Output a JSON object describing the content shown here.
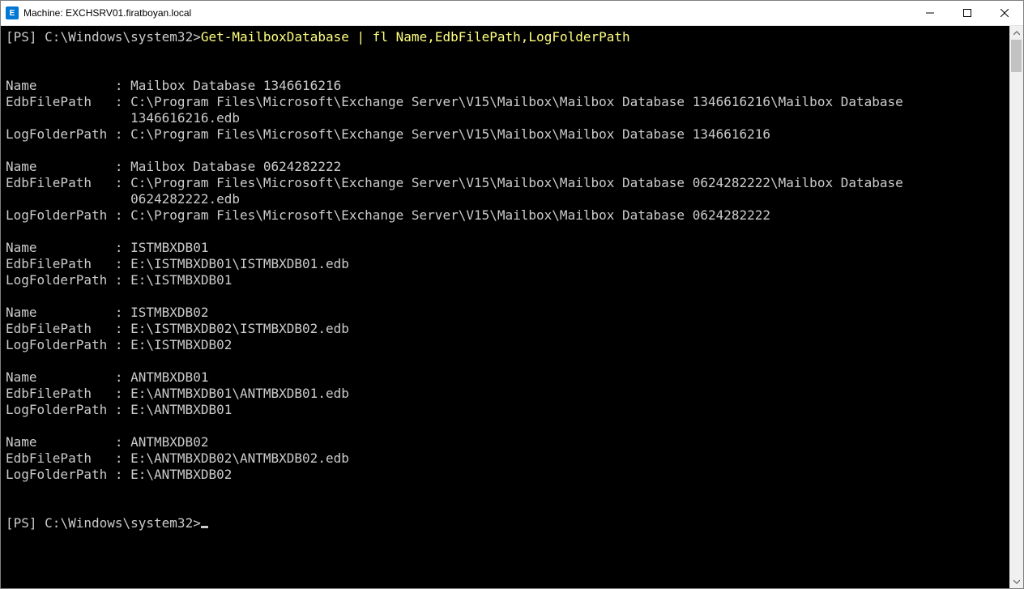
{
  "window": {
    "title": "Machine: EXCHSRV01.firatboyan.local",
    "app_icon_letter": "E"
  },
  "colors": {
    "prompt_fg": "#cccccc",
    "command_fg": "#ffff80",
    "output_fg": "#cccccc",
    "console_bg": "#000000",
    "titlebar_bg": "#ffffff",
    "accent": "#0078d4"
  },
  "prompt": {
    "label": "[PS]",
    "path": "C:\\Windows\\system32",
    "sep": ">"
  },
  "command": "Get-MailboxDatabase | fl Name,EdbFilePath,LogFolderPath",
  "blank": "",
  "output": {
    "r0": {
      "l0": "Name          : Mailbox Database 1346616216",
      "l1": "EdbFilePath   : C:\\Program Files\\Microsoft\\Exchange Server\\V15\\Mailbox\\Mailbox Database 1346616216\\Mailbox Database",
      "l2": "                1346616216.edb",
      "l3": "LogFolderPath : C:\\Program Files\\Microsoft\\Exchange Server\\V15\\Mailbox\\Mailbox Database 1346616216"
    },
    "r1": {
      "l0": "Name          : Mailbox Database 0624282222",
      "l1": "EdbFilePath   : C:\\Program Files\\Microsoft\\Exchange Server\\V15\\Mailbox\\Mailbox Database 0624282222\\Mailbox Database",
      "l2": "                0624282222.edb",
      "l3": "LogFolderPath : C:\\Program Files\\Microsoft\\Exchange Server\\V15\\Mailbox\\Mailbox Database 0624282222"
    },
    "r2": {
      "l0": "Name          : ISTMBXDB01",
      "l1": "EdbFilePath   : E:\\ISTMBXDB01\\ISTMBXDB01.edb",
      "l2": "LogFolderPath : E:\\ISTMBXDB01"
    },
    "r3": {
      "l0": "Name          : ISTMBXDB02",
      "l1": "EdbFilePath   : E:\\ISTMBXDB02\\ISTMBXDB02.edb",
      "l2": "LogFolderPath : E:\\ISTMBXDB02"
    },
    "r4": {
      "l0": "Name          : ANTMBXDB01",
      "l1": "EdbFilePath   : E:\\ANTMBXDB01\\ANTMBXDB01.edb",
      "l2": "LogFolderPath : E:\\ANTMBXDB01"
    },
    "r5": {
      "l0": "Name          : ANTMBXDB02",
      "l1": "EdbFilePath   : E:\\ANTMBXDB02\\ANTMBXDB02.edb",
      "l2": "LogFolderPath : E:\\ANTMBXDB02"
    }
  }
}
